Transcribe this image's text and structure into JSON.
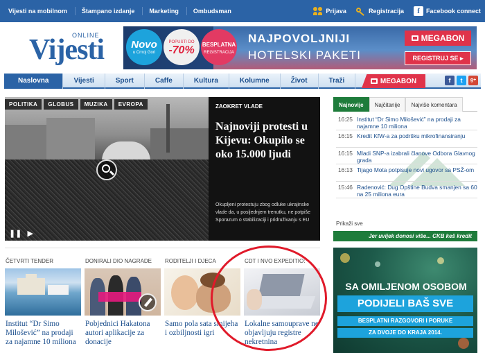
{
  "topbar": {
    "links": [
      "Vijesti na mobilnom",
      "Štampano izdanje",
      "Marketing",
      "Ombudsman"
    ],
    "prijava": "Prijava",
    "registracija": "Registracija",
    "facebook": "Facebook connect"
  },
  "logo": {
    "online": "ONLINE",
    "wordmark": "Vijesti"
  },
  "banner": {
    "novo_big": "Novo",
    "novo_small": "u Crnoj Gori",
    "popust_small": "POPUSTI DO",
    "popust_big": "-70%",
    "besplatna_big": "BESPLATNA",
    "besplatna_small": "REGISTRACIJA",
    "headline1": "NAJPOVOLJNIJI",
    "headline2": "HOTELSKI PAKETI",
    "brand": "MEGABON",
    "cta": "REGISTRUJ SE ▸"
  },
  "nav": {
    "items": [
      "Naslovna",
      "Vijesti",
      "Sport",
      "Caffe",
      "Kultura",
      "Kolumne",
      "Život",
      "Traži"
    ],
    "megabon": "MEGABON",
    "social": [
      "f",
      "t",
      "g+"
    ]
  },
  "hero": {
    "categories": [
      "POLITIKA",
      "GLOBUS",
      "MUZIKA",
      "EVROPA"
    ],
    "kicker": "ZAOKRET VLADE",
    "title": "Najnoviji protesti u Kijevu: Okupilo se oko 15.000 ljudi",
    "summary": "Okupljeni protestuju zbog odluke ukrajinske vlade da, u posljednjem trenutku, ne potpiše Sporazum o stabilizaciji i pridruživanju s EU",
    "pause": "❚❚",
    "next": "▶"
  },
  "cards": [
    {
      "kicker": "ČETVRTI TENDER",
      "title": "Institut “Dr Simo Milošević” na prodaji za najamne 10 miliona"
    },
    {
      "kicker": "DONIRALI DIO NAGRADE",
      "title": "Pobjednici Hakatona autori aplikacije za donacije"
    },
    {
      "kicker": "RODITELJI I DJECA",
      "title": "Samo pola sata smijeha i ozbiljnosti igri"
    },
    {
      "kicker": "CDT I NVO EXPEDITIO:",
      "title": "Lokalne samouprave ne objavljuju registre nekretnina"
    }
  ],
  "sidebar": {
    "tabs": [
      "Najnovije",
      "Najčitanije",
      "Najviše komentara"
    ],
    "news": [
      {
        "time": "16:25",
        "text": "Institut “Dr Simo Milošević” na prodaji za najamne 10 miliona"
      },
      {
        "time": "16:15",
        "text": "Kredit KfW-a za podršku mikrofinansiranju"
      },
      {
        "time": "16:15",
        "text": "Mladi SNP-a izabrali članove Odbora Glavnog grada"
      },
      {
        "time": "16:13",
        "text": "Tijago Mota potpisuje novi ugovor sa PSŽ-om"
      },
      {
        "time": "15:46",
        "text": "Radenović: Dug Opštine Budva smanjen sa 60 na 25 miliona eura"
      }
    ],
    "more": "Prikaži sve",
    "ckb": "Jer uvijek donosi više... CKB keš kredit"
  },
  "ad": {
    "line1": "SA OMILJENOM OSOBOM",
    "line2": "PODIJELI BAŠ SVE",
    "line3": "BESPLATNI RAZGOVORI I PORUKE",
    "line4": "ZA DVOJE DO KRAJA 2014."
  },
  "colors": {
    "brand_blue": "#2b63a6",
    "accent_red": "#e0334a",
    "sidebar_green": "#1e7c3b",
    "annotation_red": "#e01a2a"
  }
}
